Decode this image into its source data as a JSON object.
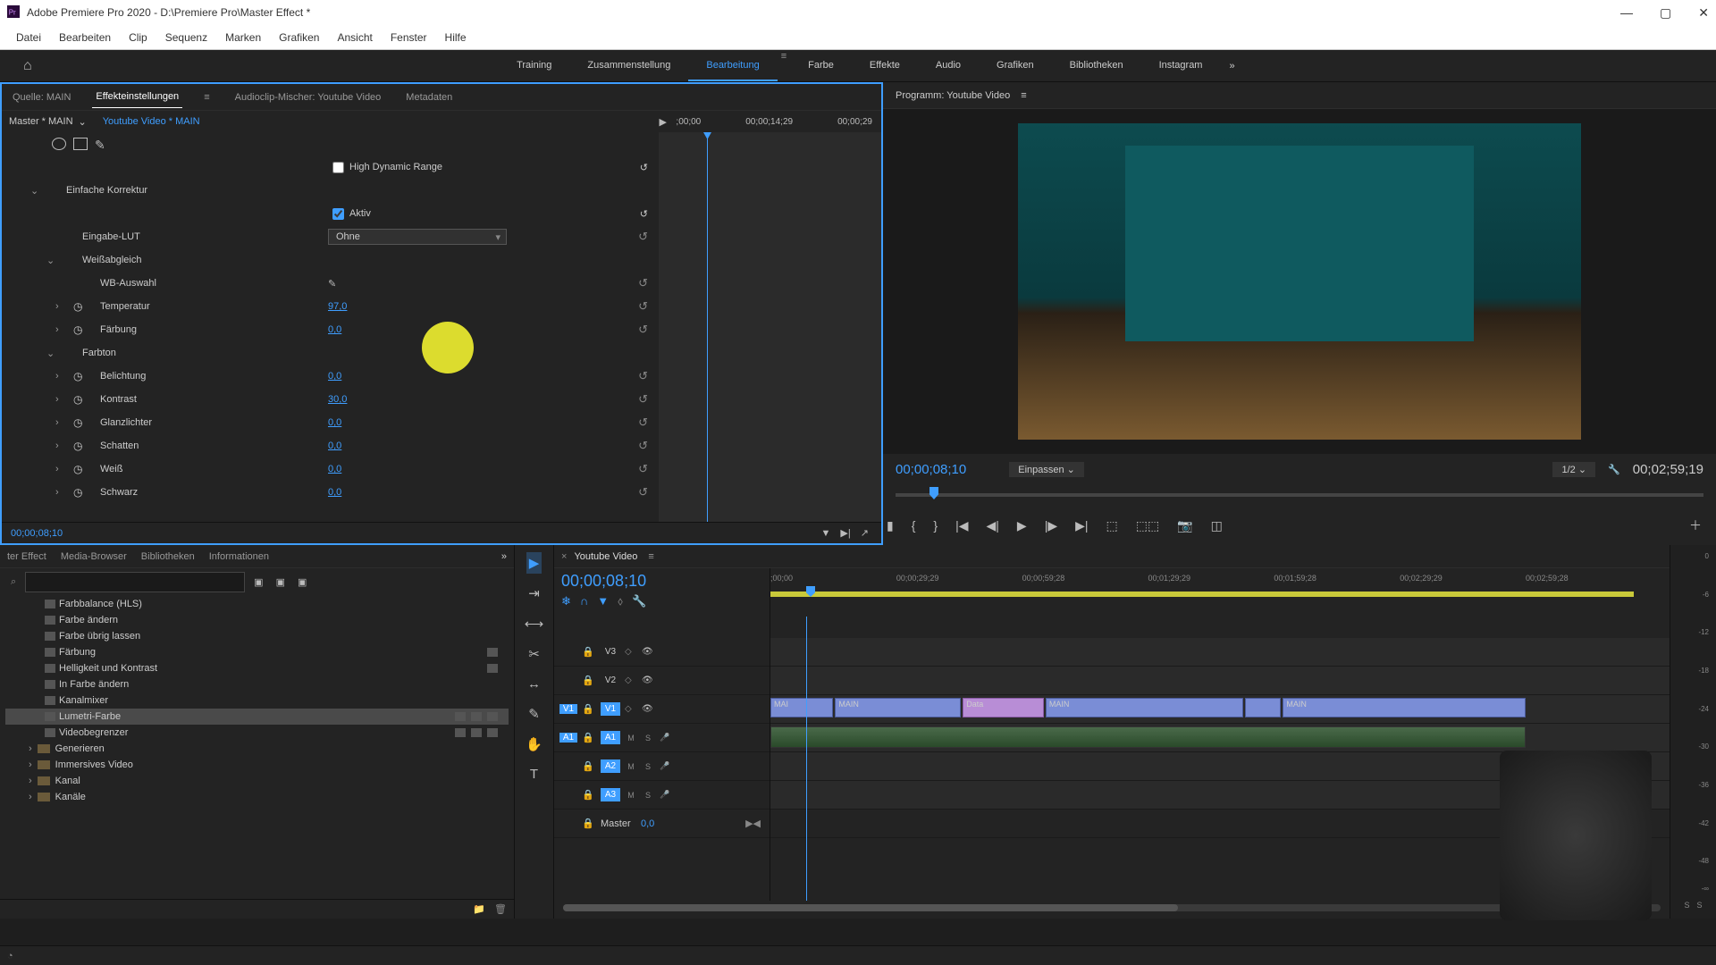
{
  "app": {
    "title": "Adobe Premiere Pro 2020 - D:\\Premiere Pro\\Master Effect *"
  },
  "menubar": [
    "Datei",
    "Bearbeiten",
    "Clip",
    "Sequenz",
    "Marken",
    "Grafiken",
    "Ansicht",
    "Fenster",
    "Hilfe"
  ],
  "workspaces": {
    "tabs": [
      "Training",
      "Zusammenstellung",
      "Bearbeitung",
      "Farbe",
      "Effekte",
      "Audio",
      "Grafiken",
      "Bibliotheken",
      "Instagram"
    ],
    "active": "Bearbeitung"
  },
  "effectControls": {
    "panelTabs": {
      "source": "Quelle: MAIN",
      "effectSettings": "Effekteinstellungen",
      "audioClipMixer": "Audioclip-Mischer: Youtube Video",
      "metadata": "Metadaten"
    },
    "masterClip": "Master * MAIN",
    "sequenceClip": "Youtube Video * MAIN",
    "timelineLabels": [
      ";00;00",
      "00;00;14;29",
      "00;00;29"
    ],
    "hdr_label": "High Dynamic Range",
    "hdr_checked": false,
    "section_basic": "Einfache Korrektur",
    "active_label": "Aktiv",
    "active_checked": true,
    "inputLUT_label": "Eingabe-LUT",
    "inputLUT_value": "Ohne",
    "whiteBalance_label": "Weißabgleich",
    "wbSelection_label": "WB-Auswahl",
    "temperature_label": "Temperatur",
    "temperature_value": "97,0",
    "tint_label": "Färbung",
    "tint_value": "0,0",
    "tone_label": "Farbton",
    "exposure_label": "Belichtung",
    "exposure_value": "0,0",
    "contrast_label": "Kontrast",
    "contrast_value": "30,0",
    "highlights_label": "Glanzlichter",
    "highlights_value": "0,0",
    "shadows_label": "Schatten",
    "shadows_value": "0,0",
    "whites_label": "Weiß",
    "whites_value": "0,0",
    "blacks_label": "Schwarz",
    "blacks_value": "0,0",
    "footerTC": "00;00;08;10"
  },
  "program": {
    "title": "Programm: Youtube Video",
    "timecode": "00;00;08;10",
    "fit": "Einpassen",
    "zoom": "1/2",
    "duration": "00;02;59;19"
  },
  "projectPanel": {
    "tabs": [
      "ter Effect",
      "Media-Browser",
      "Bibliotheken",
      "Informationen"
    ],
    "searchPlaceholder": "",
    "effects": [
      "Farbbalance (HLS)",
      "Farbe ändern",
      "Farbe übrig lassen",
      "Färbung",
      "Helligkeit und Kontrast",
      "In Farbe ändern",
      "Kanalmixer",
      "Lumetri-Farbe",
      "Videobegrenzer"
    ],
    "selected": "Lumetri-Farbe",
    "folders": [
      "Generieren",
      "Immersives Video",
      "Kanal",
      "Kanäle"
    ]
  },
  "timeline": {
    "seqName": "Youtube Video",
    "timecode": "00;00;08;10",
    "rulerTicks": [
      ";00;00",
      "00;00;29;29",
      "00;00;59;28",
      "00;01;29;29",
      "00;01;59;28",
      "00;02;29;29",
      "00;02;59;28"
    ],
    "tracks": {
      "v3": "V3",
      "v2": "V2",
      "v1": "V1",
      "a1": "A1",
      "a2": "A2",
      "a3": "A3",
      "v1src": "V1",
      "a1src": "A1",
      "master": "Master",
      "masterVal": "0,0"
    },
    "clips": {
      "c1": "MAI",
      "c2": "MAIN",
      "c3": "Data",
      "c4": "MAIN",
      "c5": "MAIN"
    }
  },
  "audioMeter": {
    "scale": [
      "0",
      "-6",
      "-12",
      "-18",
      "-24",
      "-30",
      "-36",
      "-42",
      "-48",
      "-∞"
    ],
    "solo": "S"
  }
}
